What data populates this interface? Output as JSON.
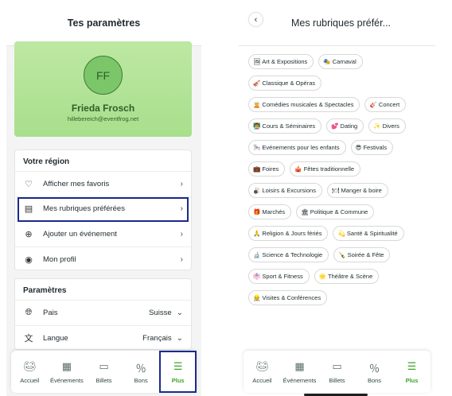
{
  "left": {
    "header_title": "Tes paramètres",
    "profile": {
      "initials": "FF",
      "name": "Frieda Frosch",
      "email": "hillebereich@eventfrog.net"
    },
    "region_card": {
      "title": "Votre région",
      "items": [
        {
          "label": "Afficher mes favoris",
          "icon": "heart-icon"
        },
        {
          "label": "Mes rubriques préférées",
          "icon": "categories-icon"
        },
        {
          "label": "Ajouter un événement",
          "icon": "plus-circle-icon"
        },
        {
          "label": "Mon profil",
          "icon": "user-circle-icon"
        }
      ]
    },
    "params_card": {
      "title": "Paramètres",
      "items": [
        {
          "label": "Pais",
          "value": "Suisse",
          "icon": "globe-icon"
        },
        {
          "label": "Langue",
          "value": "Français",
          "icon": "translate-icon"
        }
      ]
    }
  },
  "right": {
    "header_title": "Mes rubriques préfér...",
    "categories": [
      [
        "🖼 Art & Expositions",
        "🎭 Carnaval"
      ],
      [
        "🎻 Classique & Opéras"
      ],
      [
        "🧝 Comédies musicales & Spectacles",
        "🎸 Concert"
      ],
      [
        "👨‍🏫 Cours & Séminaires",
        "💕 Dating",
        "✨ Divers"
      ],
      [
        "🎠 Evénements pour les enfants",
        "😎 Festivals"
      ],
      [
        "💼 Foires",
        "🎪 Fêtes traditionnelle"
      ],
      [
        "🎳 Loisirs & Excursions",
        "🍽 Manger & boire"
      ],
      [
        "🎁 Marchés",
        "🏛 Politique & Commune"
      ],
      [
        "🙏 Religion & Jours fériés",
        "💫 Santé & Spiritualité"
      ],
      [
        "🔬 Science & Technologie",
        "🍾 Soirée & Fête"
      ],
      [
        "👘 Sport & Fitness",
        "🌟 Théâtre & Scène"
      ],
      [
        "👷 Visites & Conférences"
      ]
    ]
  },
  "tabbar": {
    "items": [
      {
        "label": "Accueil",
        "icon": "frog-icon"
      },
      {
        "label": "Événements",
        "icon": "calendar-icon"
      },
      {
        "label": "Billets",
        "icon": "ticket-icon"
      },
      {
        "label": "Bons",
        "icon": "voucher-icon"
      },
      {
        "label": "Plus",
        "icon": "menu-icon"
      }
    ]
  },
  "colors": {
    "accent_green": "#3fa52c",
    "profile_green": "#a8df8c",
    "highlight_blue": "#1a2a8c"
  }
}
